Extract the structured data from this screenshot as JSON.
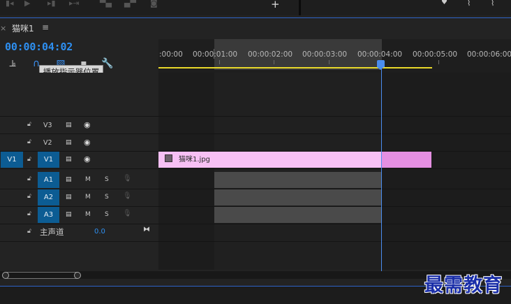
{
  "panel": {
    "close": "×",
    "title": "猫咪1",
    "menu": "≡"
  },
  "timecode": "00:00:04:02",
  "tooltip": "播放指示器位置",
  "ruler": {
    "ticks": [
      ":00:00",
      "00:00:01:00",
      "00:00:02:00",
      "00:00:03:00",
      "00:00:04:00",
      "00:00:05:00",
      "00:00:06:00"
    ]
  },
  "tracks": {
    "video": [
      {
        "name": "V3",
        "source": ""
      },
      {
        "name": "V2",
        "source": ""
      },
      {
        "name": "V1",
        "source": "V1"
      }
    ],
    "audio": [
      {
        "name": "A1",
        "m": "M",
        "s": "S"
      },
      {
        "name": "A2",
        "m": "M",
        "s": "S"
      },
      {
        "name": "A3",
        "m": "M",
        "s": "S"
      }
    ],
    "master": {
      "name": "主声道",
      "volume": "0.0"
    }
  },
  "clip": {
    "label": "猫咪1.jpg"
  },
  "watermark": "最需教育",
  "colors": {
    "accent": "#2e8ff0",
    "clip": "#f7c0f4",
    "workbar": "#e9d92a",
    "track_target": "#0c5c93"
  }
}
